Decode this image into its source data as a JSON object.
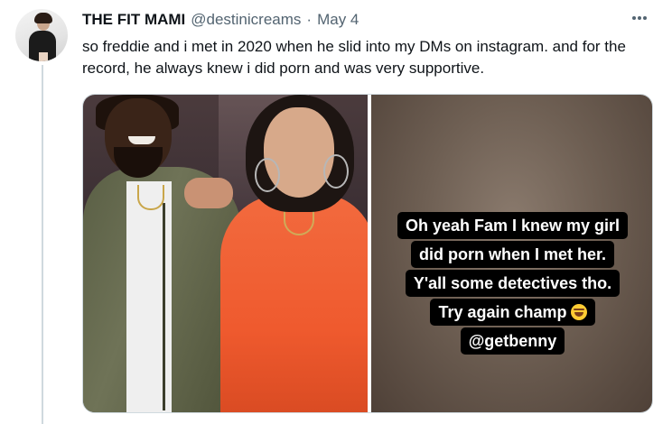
{
  "tweet": {
    "author": {
      "display_name": "THE FIT MAMI",
      "handle": "@destinicreams",
      "separator": "·",
      "date": "May 4"
    },
    "text": "so freddie and i met in 2020 when he slid into my DMs on instagram. and for the record, he always knew i did porn and was very supportive.",
    "more_icon": "ellipsis-icon"
  },
  "media": {
    "right_image_caption_lines": [
      "Oh yeah Fam I knew my girl",
      "did porn when I met her.",
      "Y'all some detectives tho.",
      "Try again champ",
      "@getbenny"
    ],
    "emoji_icon": "laughing-crying-emoji-icon"
  }
}
